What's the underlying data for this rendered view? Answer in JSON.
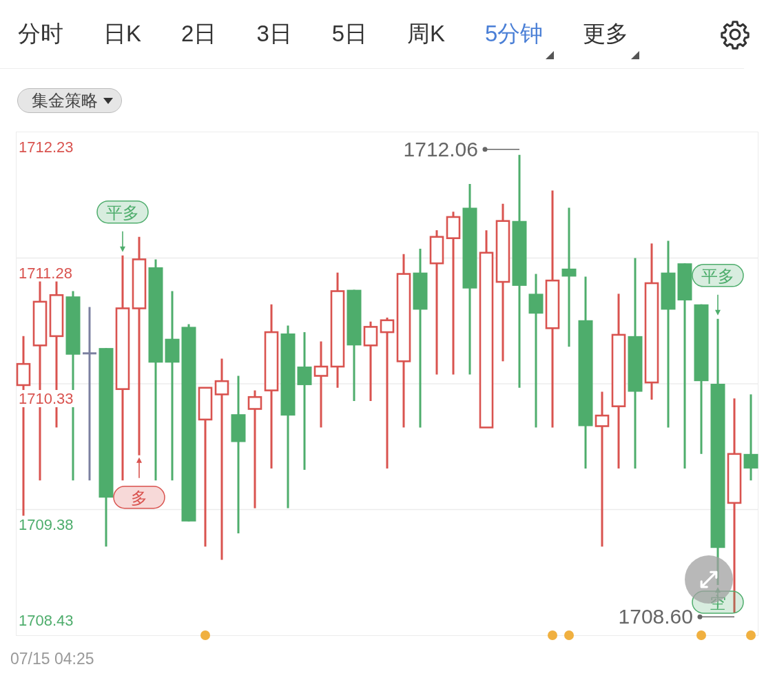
{
  "tabs": [
    {
      "label": "分时",
      "selected": false,
      "has_menu": false
    },
    {
      "label": "日K",
      "selected": false,
      "has_menu": false
    },
    {
      "label": "2日",
      "selected": false,
      "has_menu": false
    },
    {
      "label": "3日",
      "selected": false,
      "has_menu": false
    },
    {
      "label": "5日",
      "selected": false,
      "has_menu": false
    },
    {
      "label": "周K",
      "selected": false,
      "has_menu": false
    },
    {
      "label": "5分钟",
      "selected": true,
      "has_menu": true
    },
    {
      "label": "更多",
      "selected": false,
      "has_menu": true
    }
  ],
  "strategy_dropdown": {
    "label": "集金策略"
  },
  "chart": {
    "price_labels": [
      {
        "text": "1712.23",
        "color": "#d9534f"
      },
      {
        "text": "1711.28",
        "color": "#d9534f"
      },
      {
        "text": "1710.33",
        "color": "#d9534f"
      },
      {
        "text": "1709.38",
        "color": "#4ead6c"
      },
      {
        "text": "1708.43",
        "color": "#4ead6c"
      }
    ],
    "price_marks": [
      {
        "label": "1712.06"
      },
      {
        "label": "1708.60"
      }
    ],
    "signals": [
      {
        "label": "平多",
        "color": "#4ead6c"
      },
      {
        "label": "多",
        "color": "#d9534f"
      },
      {
        "label": "平多",
        "color": "#4ead6c"
      },
      {
        "label": "空",
        "color": "#4ead6c"
      }
    ]
  },
  "timestamp": "07/15 04:25"
}
